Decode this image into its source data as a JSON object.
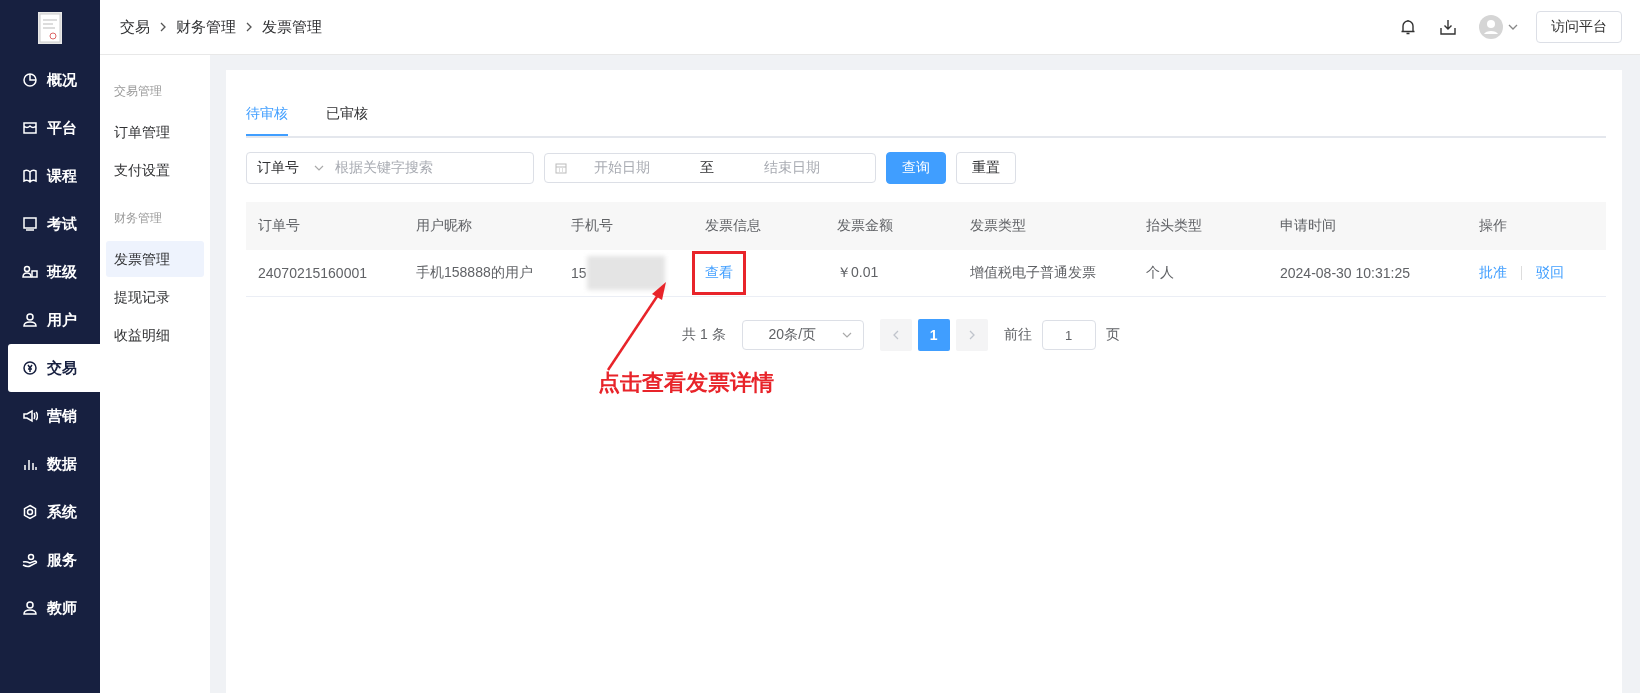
{
  "sidebar": {
    "items": [
      {
        "label": "概况",
        "selected": false
      },
      {
        "label": "平台",
        "selected": false
      },
      {
        "label": "课程",
        "selected": false
      },
      {
        "label": "考试",
        "selected": false
      },
      {
        "label": "班级",
        "selected": false
      },
      {
        "label": "用户",
        "selected": false
      },
      {
        "label": "交易",
        "selected": true
      },
      {
        "label": "营销",
        "selected": false
      },
      {
        "label": "数据",
        "selected": false
      },
      {
        "label": "系统",
        "selected": false
      },
      {
        "label": "服务",
        "selected": false
      },
      {
        "label": "教师",
        "selected": false
      }
    ]
  },
  "sub_nav": {
    "groups": [
      {
        "title": "交易管理",
        "items": [
          {
            "label": "订单管理",
            "selected": false
          },
          {
            "label": "支付设置",
            "selected": false
          }
        ]
      },
      {
        "title": "财务管理",
        "items": [
          {
            "label": "发票管理",
            "selected": true
          },
          {
            "label": "提现记录",
            "selected": false
          },
          {
            "label": "收益明细",
            "selected": false
          }
        ]
      }
    ]
  },
  "breadcrumb": [
    "交易",
    "财务管理",
    "发票管理"
  ],
  "header": {
    "button": "访问平台"
  },
  "tabs": [
    {
      "label": "待审核",
      "selected": true
    },
    {
      "label": "已审核",
      "selected": false
    }
  ],
  "filters": {
    "search_type": "订单号",
    "search_placeholder": "根据关键字搜索",
    "start_placeholder": "开始日期",
    "range_separator": "至",
    "end_placeholder": "结束日期",
    "buttons": [
      {
        "label": "查询",
        "kind": "primary"
      },
      {
        "label": "重置",
        "kind": "plain"
      }
    ]
  },
  "table": {
    "columns": [
      "订单号",
      "用户昵称",
      "手机号",
      "发票信息",
      "发票金额",
      "发票类型",
      "抬头类型",
      "申请时间",
      "操作"
    ],
    "rows": [
      {
        "order_no": "24070215160001",
        "nickname": "手机158888的用户",
        "phone": "15",
        "invoice_info": "查看",
        "amount": "￥0.01",
        "invoice_type": "增值税电子普通发票",
        "title_type": "个人",
        "applied_at": "2024-08-30 10:31:25",
        "actions": [
          "批准",
          "驳回"
        ]
      }
    ]
  },
  "pagination": {
    "total": "共 1 条",
    "page_size": "20条/页",
    "pages": [
      {
        "label": "1",
        "selected": true
      }
    ],
    "goto_label": "前往",
    "goto_value": "1",
    "goto_suffix": "页"
  },
  "annotation": {
    "text": "点击查看发票详情"
  }
}
